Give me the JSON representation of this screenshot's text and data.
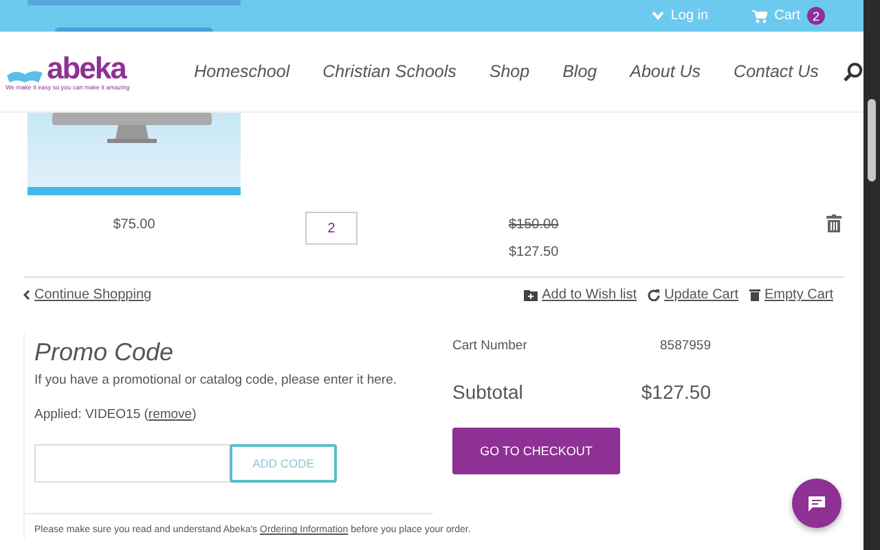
{
  "top_bar": {
    "login": "Log in",
    "cart": "Cart",
    "cart_count": "2"
  },
  "logo": {
    "name": "abeka",
    "tagline": "We make it easy so you can make it amazing"
  },
  "nav": [
    "Homeschool",
    "Christian Schools",
    "Shop",
    "Blog",
    "About Us",
    "Contact Us"
  ],
  "cart_item": {
    "price": "$75.00",
    "quantity": "2",
    "original_total": "$150.00",
    "total": "$127.50"
  },
  "cart_actions": {
    "continue": "Continue Shopping",
    "wish_list": "Add to Wish list",
    "update": "Update Cart",
    "empty": "Empty Cart"
  },
  "promo": {
    "title": "Promo Code",
    "description": "If you have a promotional or catalog code, please enter it here.",
    "applied_before": "Applied: VIDEO15 (",
    "remove": "remove",
    "applied_after": ")",
    "add_button": "ADD CODE"
  },
  "summary": {
    "cart_number_label": "Cart Number",
    "cart_number": "8587959",
    "subtotal_label": "Subtotal",
    "subtotal": "$127.50",
    "checkout_button": "GO TO CHECKOUT"
  },
  "note": {
    "before": "Please make sure you read and understand Abeka's ",
    "link": "Ordering Information",
    "after": " before you place your order."
  }
}
